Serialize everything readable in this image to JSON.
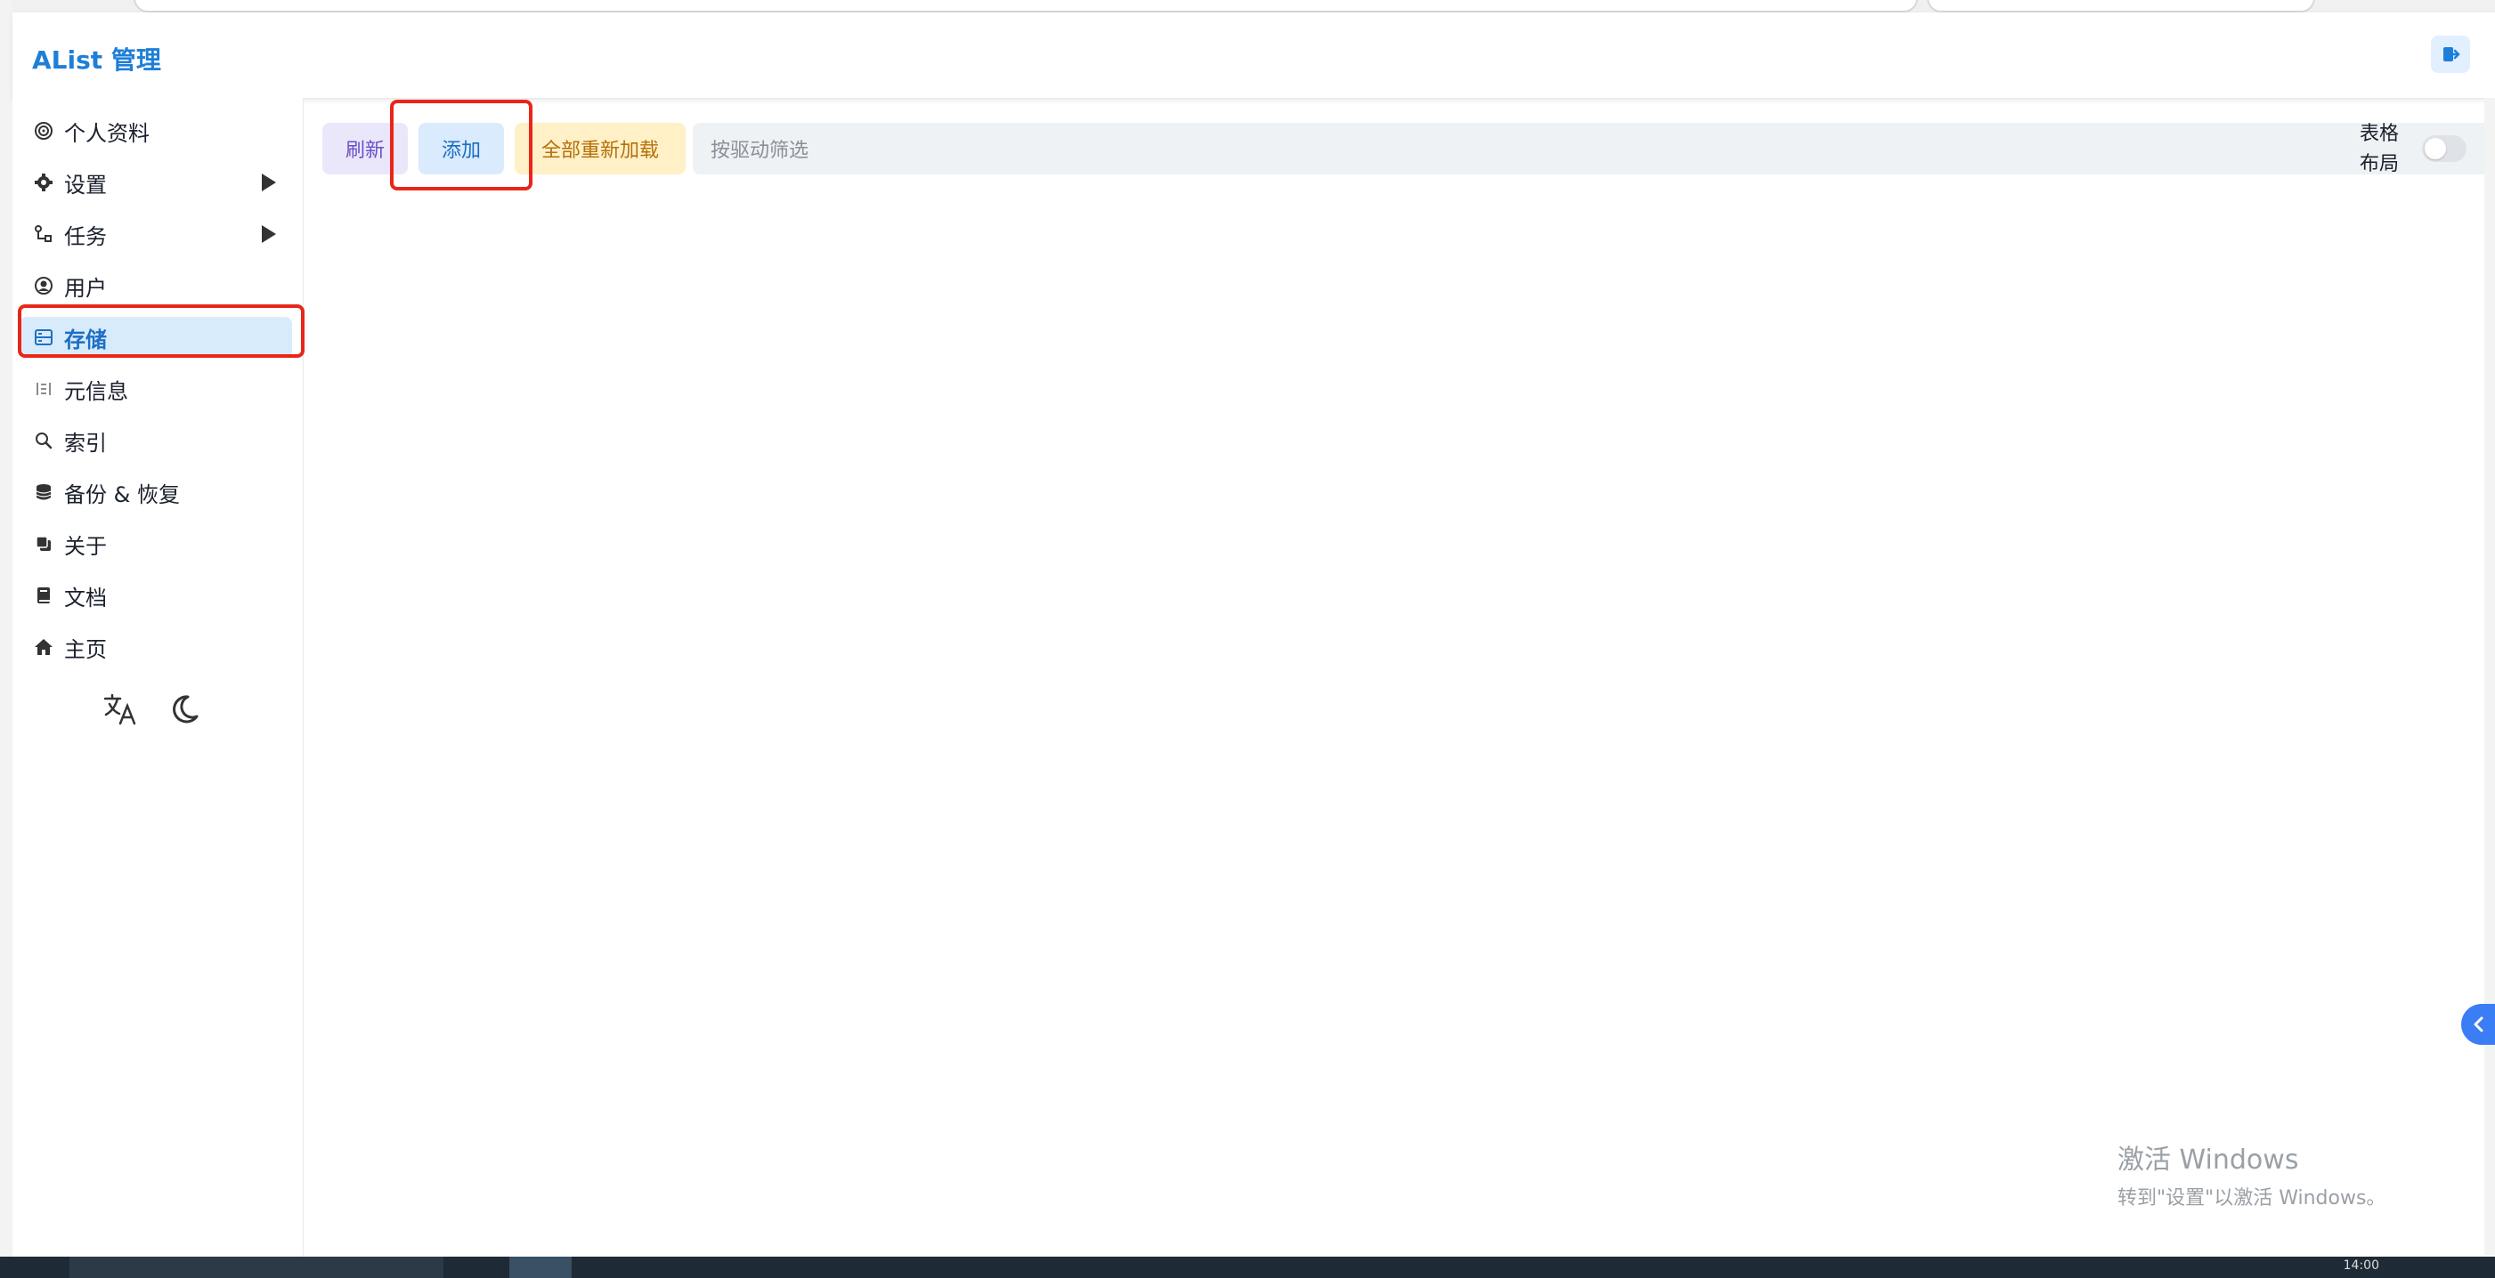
{
  "app": {
    "title": "AList 管理"
  },
  "sidebar": {
    "items": [
      {
        "label": "个人资料",
        "icon": "fingerprint-icon"
      },
      {
        "label": "设置",
        "icon": "gear-icon",
        "expandable": true
      },
      {
        "label": "任务",
        "icon": "flow-icon",
        "expandable": true
      },
      {
        "label": "用户",
        "icon": "user-circle-icon"
      },
      {
        "label": "存储",
        "icon": "database-icon",
        "active": true
      },
      {
        "label": "元信息",
        "icon": "meta-icon"
      },
      {
        "label": "索引",
        "icon": "search-icon"
      },
      {
        "label": "备份 & 恢复",
        "icon": "backup-icon"
      },
      {
        "label": "关于",
        "icon": "copy-icon"
      },
      {
        "label": "文档",
        "icon": "book-icon"
      },
      {
        "label": "主页",
        "icon": "home-icon"
      }
    ],
    "bottom_icons": [
      "translate-icon",
      "moon-icon"
    ]
  },
  "toolbar": {
    "refresh_label": "刷新",
    "add_label": "添加",
    "reload_all_label": "全部重新加载",
    "filter_placeholder": "按驱动筛选",
    "layout_toggle_label_line1": "表格",
    "layout_toggle_label_line2": "布局",
    "layout_toggle_on": false
  },
  "watermark": {
    "line1": "激活 Windows",
    "line2": "转到\"设置\"以激活 Windows。"
  },
  "taskbar": {
    "clock": "14:00"
  },
  "colors": {
    "accent": "#1e7fd8",
    "active_bg": "#d8ebfb",
    "highlight_red": "#e8261a",
    "refresh_bg": "#ebe7fb",
    "add_bg": "#d9ebfd",
    "reload_bg": "#fff0c7"
  }
}
